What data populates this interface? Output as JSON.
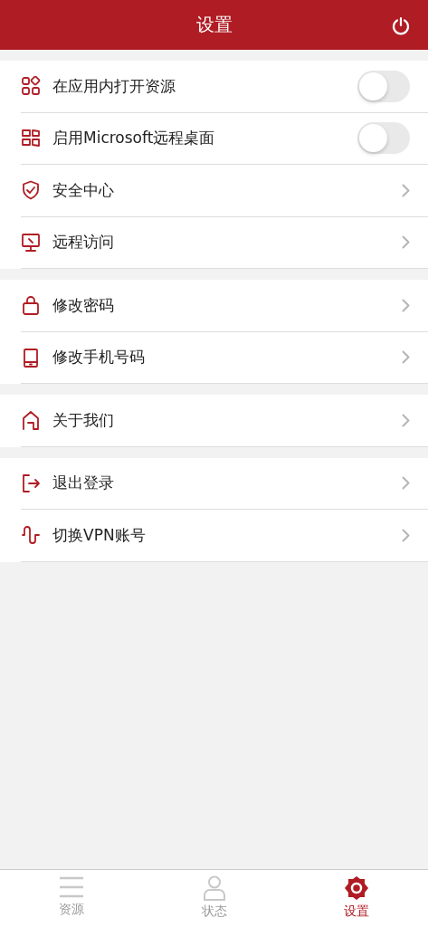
{
  "header": {
    "title": "设置"
  },
  "groups": [
    {
      "items": [
        {
          "kind": "toggle",
          "label": "在应用内打开资源",
          "on": false
        },
        {
          "kind": "toggle",
          "label": "启用Microsoft远程桌面",
          "on": false
        },
        {
          "kind": "link",
          "label": "安全中心"
        },
        {
          "kind": "link",
          "label": "远程访问"
        }
      ]
    },
    {
      "items": [
        {
          "kind": "link",
          "label": "修改密码"
        },
        {
          "kind": "link",
          "label": "修改手机号码"
        }
      ]
    },
    {
      "items": [
        {
          "kind": "link",
          "label": "关于我们"
        }
      ]
    },
    {
      "items": [
        {
          "kind": "link",
          "label": "退出登录"
        },
        {
          "kind": "link",
          "label": "切换VPN账号"
        }
      ]
    }
  ],
  "tabs": [
    {
      "label": "资源",
      "selected": false
    },
    {
      "label": "状态",
      "selected": false
    },
    {
      "label": "设置",
      "selected": true
    }
  ]
}
